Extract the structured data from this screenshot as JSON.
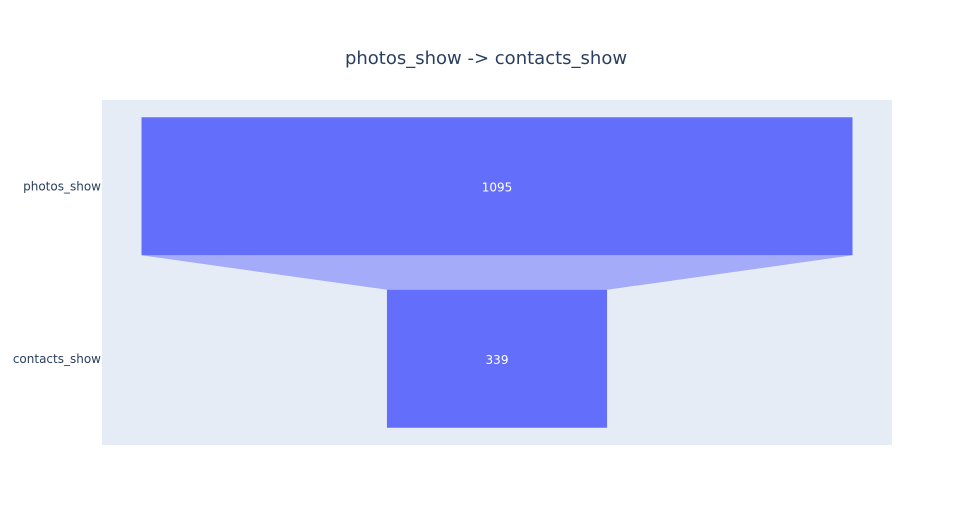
{
  "chart_data": {
    "type": "funnel",
    "title": "photos_show -> contacts_show",
    "categories": [
      "photos_show",
      "contacts_show"
    ],
    "values": [
      1095,
      339
    ],
    "text_labels": [
      "1095",
      "339"
    ],
    "colors": {
      "bar": "#636efa",
      "connector": "#a4abf8",
      "plot_background": "#e5ecf6",
      "title": "#2a3f5f",
      "tick_label": "#2a3f5f",
      "data_label": "#ffffff"
    },
    "grid": false,
    "legend": "none"
  }
}
